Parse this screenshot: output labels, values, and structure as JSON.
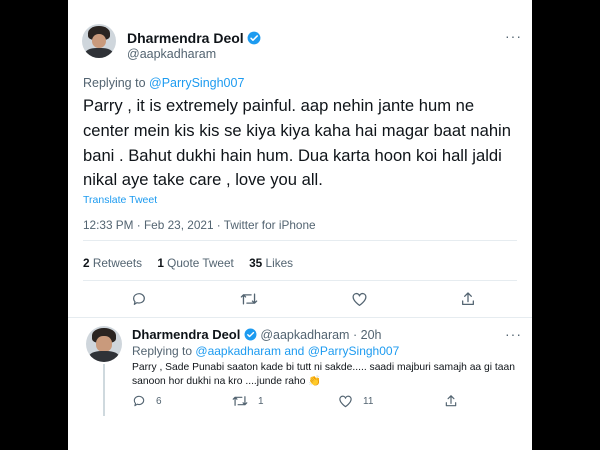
{
  "tweet": {
    "name": "Dharmendra Deol",
    "handle": "@aapkadharam",
    "replying_to_prefix": "Replying to",
    "replying_to": "@ParrySingh007",
    "body": "Parry , it is extremely painful. aap nehin jante hum ne center mein kis kis se kiya kiya kaha hai magar baat nahin bani . Bahut dukhi hain hum. Dua karta hoon koi hall jaldi nikal aye take care , love you all.",
    "translate": "Translate Tweet",
    "time": "12:33 PM · Feb 23, 2021 · Twitter for iPhone",
    "retweets_count": "2",
    "retweets_label": "Retweets",
    "quotes_count": "1",
    "quotes_label": "Quote Tweet",
    "likes_count": "35",
    "likes_label": "Likes",
    "more": "···"
  },
  "reply": {
    "name": "Dharmendra Deol",
    "handle": "@aapkadharam",
    "dot": "·",
    "age": "20h",
    "replying_to_prefix": "Replying to",
    "replying_to_1": "@aapkadharam",
    "and": "and",
    "replying_to_2": "@ParrySingh007",
    "body": "Parry , Sade Punabi saaton kade bi tutt ni sakde..... saadi majburi samajh aa gi taan sanoon hor dukhi na kro ....junde raho 👏",
    "reply_count": "6",
    "retweet_count": "1",
    "like_count": "11",
    "more": "···"
  },
  "colors": {
    "accent": "#1d9bf0",
    "muted": "#536471",
    "background": "#000000",
    "card": "#ffffff"
  },
  "icons": [
    "verified-badge-icon",
    "reply-icon",
    "retweet-icon",
    "like-icon",
    "share-icon",
    "more-icon"
  ]
}
